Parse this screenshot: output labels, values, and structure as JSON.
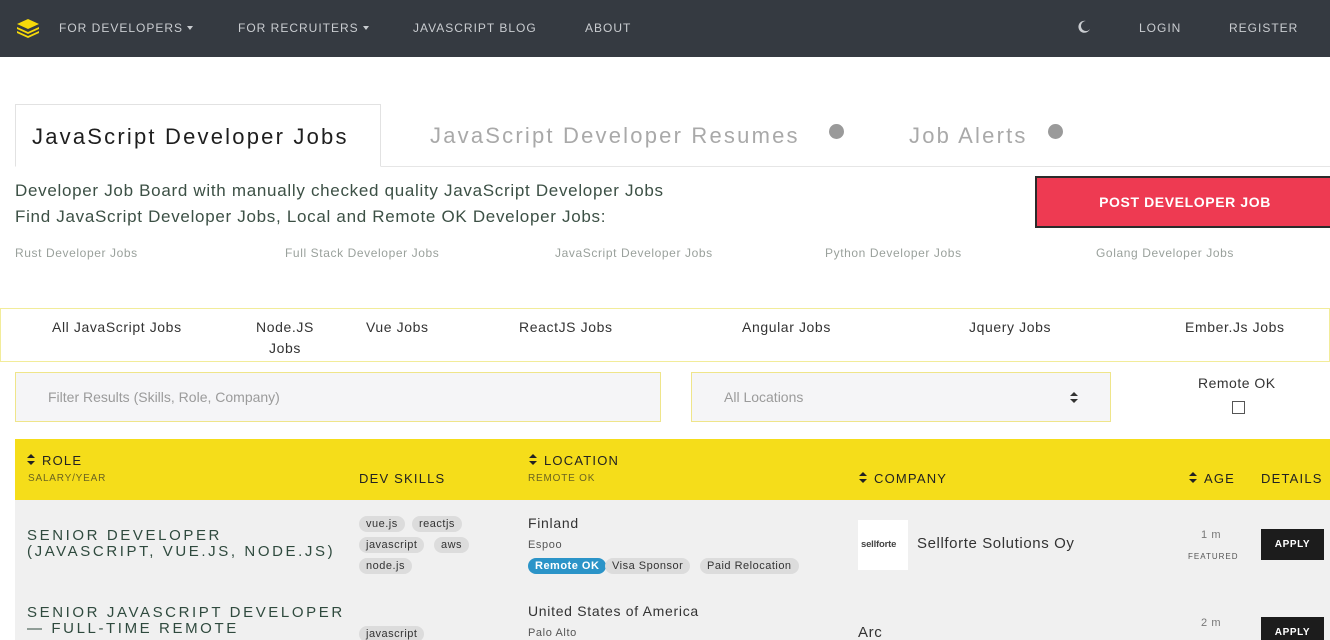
{
  "nav": {
    "for_developers": "FOR DEVELOPERS",
    "for_recruiters": "FOR RECRUITERS",
    "blog": "JAVASCRIPT BLOG",
    "about": "ABOUT",
    "login": "LOGIN",
    "register": "REGISTER",
    "logo_icon": "layers-stack-icon",
    "theme_icon": "moon-icon"
  },
  "tabs": {
    "active": "JavaScript Developer Jobs",
    "resumes": "JavaScript Developer Resumes",
    "alerts": "Job Alerts"
  },
  "intro": {
    "line1": "Developer Job Board with manually checked quality JavaScript Developer Jobs",
    "line2": "Find JavaScript Developer Jobs, Local and Remote OK Developer Jobs:"
  },
  "post_button": "POST DEVELOPER JOB",
  "related_links": [
    "Rust Developer Jobs",
    "Full Stack Developer Jobs",
    "JavaScript Developer Jobs",
    "Python Developer Jobs",
    "Golang Developer Jobs"
  ],
  "categories": [
    "All JavaScript Jobs",
    "Node.JS Jobs",
    "Vue Jobs",
    "ReactJS Jobs",
    "Angular Jobs",
    "Jquery Jobs",
    "Ember.Js Jobs"
  ],
  "filters": {
    "search_placeholder": "Filter Results (Skills, Role, Company)",
    "location_value": "All Locations",
    "remote_label": "Remote OK",
    "remote_checked": false
  },
  "table": {
    "headers": {
      "role": "ROLE",
      "salary": "SALARY/YEAR",
      "skills": "DEV SKILLS",
      "location": "LOCATION",
      "remote": "REMOTE OK",
      "company": "COMPANY",
      "age": "AGE",
      "details": "DETAILS"
    },
    "rows": [
      {
        "role": "SENIOR DEVELOPER (JAVASCRIPT, VUE.JS, NODE.JS)",
        "skills": [
          "vue.js",
          "reactjs",
          "javascript",
          "aws",
          "node.js"
        ],
        "country": "Finland",
        "city": "Espoo",
        "badges": [
          "Remote OK",
          "Visa Sponsor",
          "Paid Relocation"
        ],
        "company": "Sellforte Solutions Oy",
        "logo_text": "sellforte",
        "age": "1 m",
        "featured": "FEATURED",
        "apply": "APPLY"
      },
      {
        "role": "SENIOR JAVASCRIPT DEVELOPER — FULL-TIME REMOTE",
        "skills": [
          "javascript"
        ],
        "country": "United States of America",
        "city": "Palo Alto",
        "company": "Arc",
        "age": "2 m",
        "apply": "APPLY"
      }
    ]
  }
}
